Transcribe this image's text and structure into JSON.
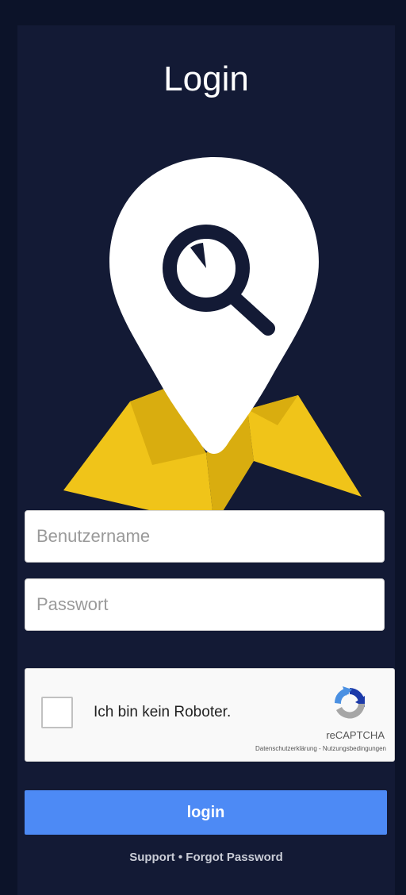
{
  "page": {
    "title": "Login"
  },
  "logo": {
    "icon": "map-pin-search-icon",
    "colors": {
      "pin": "#ffffff",
      "map": "#f0c419",
      "map_shade": "#d9ad0f",
      "lens_ring": "#131a35"
    }
  },
  "form": {
    "username_placeholder": "Benutzername",
    "password_placeholder": "Passwort"
  },
  "captcha": {
    "label": "Ich bin kein Roboter.",
    "brand": "reCAPTCHA",
    "privacy_link": "Datenschutzerklärung",
    "separator": " - ",
    "terms_link": "Nutzungsbedingungen",
    "icon": "recaptcha-icon"
  },
  "actions": {
    "login_label": "login"
  },
  "footer": {
    "support_label": "Support",
    "separator": " • ",
    "forgot_label": "Forgot Password"
  },
  "colors": {
    "background": "#0c1329",
    "panel": "#131a35",
    "button": "#4d8af5"
  }
}
